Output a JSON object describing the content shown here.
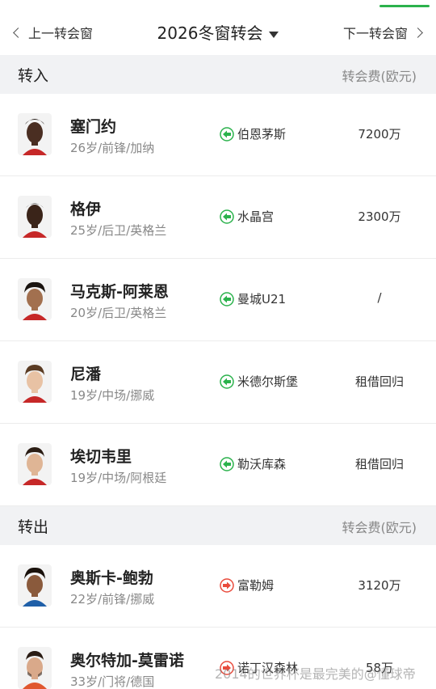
{
  "nav": {
    "prev_label": "上一转会窗",
    "title": "2026冬窗转会",
    "next_label": "下一转会窗"
  },
  "sections": {
    "in": {
      "label": "转入",
      "fee_header": "转会费(欧元)"
    },
    "out": {
      "label": "转出",
      "fee_header": "转会费(欧元)"
    }
  },
  "transfers_in": [
    {
      "name": "塞门约",
      "meta": "26岁/前锋/加纳",
      "club": "伯恩茅斯",
      "fee": "7200万"
    },
    {
      "name": "格伊",
      "meta": "25岁/后卫/英格兰",
      "club": "水晶宫",
      "fee": "2300万"
    },
    {
      "name": "马克斯-阿莱恩",
      "meta": "20岁/后卫/英格兰",
      "club": "曼城U21",
      "fee": "/"
    },
    {
      "name": "尼潘",
      "meta": "19岁/中场/挪威",
      "club": "米德尔斯堡",
      "fee": "租借回归"
    },
    {
      "name": "埃切韦里",
      "meta": "19岁/中场/阿根廷",
      "club": "勒沃库森",
      "fee": "租借回归"
    }
  ],
  "transfers_out": [
    {
      "name": "奥斯卡-鲍勃",
      "meta": "22岁/前锋/挪威",
      "club": "富勒姆",
      "fee": "3120万"
    },
    {
      "name": "奥尔特加-莫雷诺",
      "meta": "33岁/门将/德国",
      "club": "诺丁汉森林",
      "fee": "58万"
    }
  ],
  "watermark": "2014的世界杯是最完美的@懂球帝",
  "colors": {
    "accent": "#2bb24c",
    "in_icon": "#2bb24c",
    "out_icon": "#e94b3c"
  }
}
